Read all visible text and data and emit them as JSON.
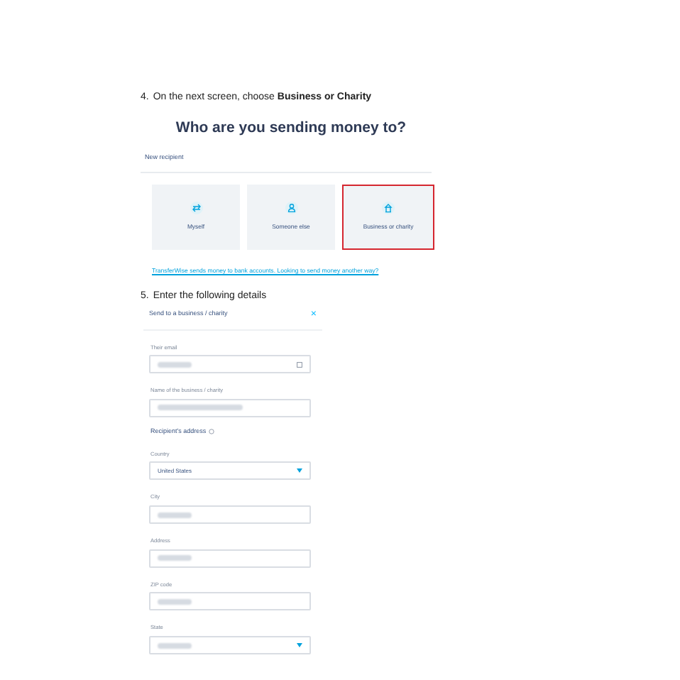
{
  "step_4": {
    "number": "4.",
    "text": "On the next screen, choose **Business or Charity**"
  },
  "recipient_screen": {
    "title": "Who are you sending money to?",
    "section": "New recipient",
    "options": [
      {
        "label": "Myself",
        "kind": "arrows",
        "selected": false
      },
      {
        "label": "Someone else",
        "kind": "person",
        "selected": false
      },
      {
        "label": "Business or charity",
        "kind": "building",
        "selected": true
      }
    ],
    "link": "TransferWise sends money to bank accounts. Looking to send money another way?"
  },
  "step_5": {
    "number": "5.",
    "text": "Enter the following details"
  },
  "form": {
    "title": "Send to a business / charity",
    "close": "×",
    "fields": [
      {
        "kind": "input",
        "label": "Their email",
        "value_hidden": true,
        "trailing_icon": true
      },
      {
        "kind": "input",
        "label": "Name of the business / charity",
        "value_hidden": true
      },
      {
        "kind": "heading",
        "label": "Recipient's address"
      },
      {
        "kind": "select",
        "label": "Country",
        "value": "United States"
      },
      {
        "kind": "input",
        "label": "City",
        "value_hidden": true
      },
      {
        "kind": "input",
        "label": "Address",
        "value_hidden": true
      },
      {
        "kind": "input",
        "label": "ZIP code",
        "value_hidden": true
      },
      {
        "kind": "select",
        "label": "State",
        "value_hidden": true
      }
    ]
  }
}
